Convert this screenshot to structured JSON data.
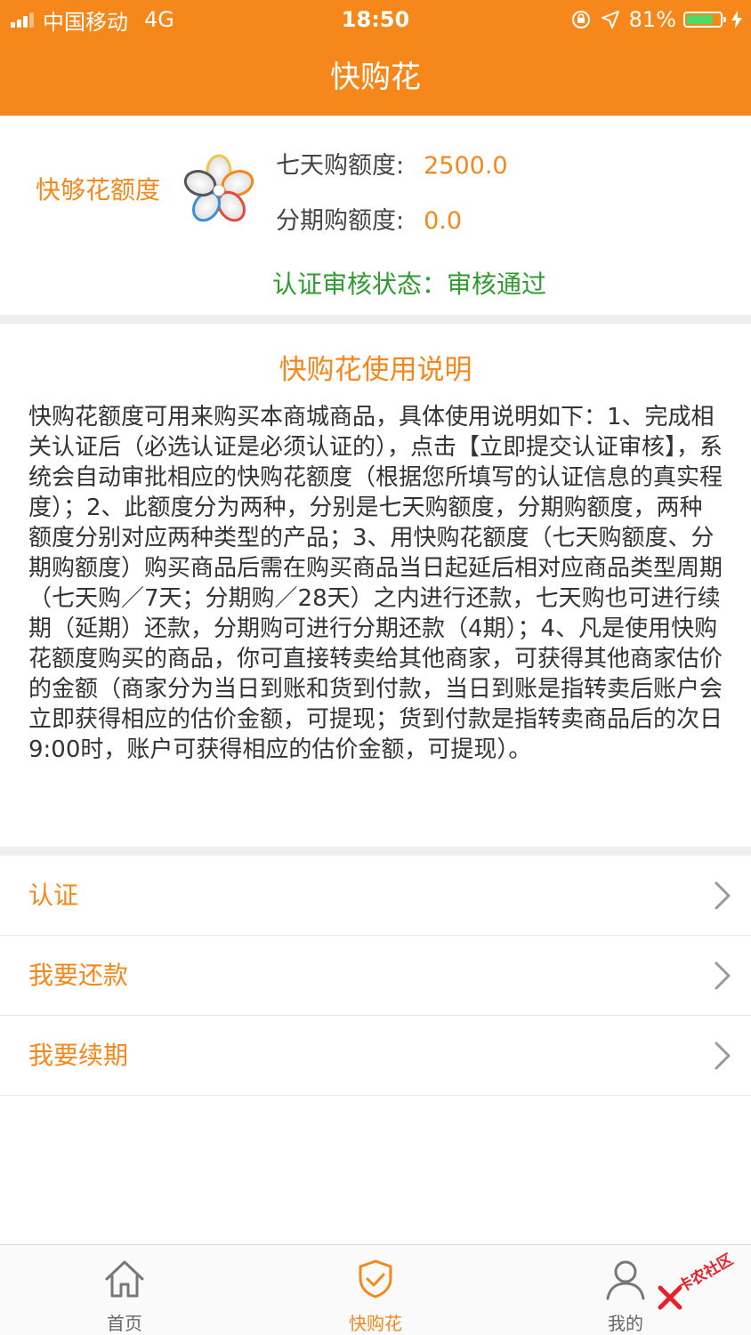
{
  "status_bar": {
    "carrier": "中国移动",
    "network": "4G",
    "time": "18:50",
    "battery_percent": "81%",
    "battery_level": 0.81
  },
  "nav": {
    "title": "快购花"
  },
  "quota": {
    "label": "快够花额度",
    "seven_day_label": "七天购额度:",
    "seven_day_value": "2500.0",
    "installment_label": "分期购额度:",
    "installment_value": "0.0",
    "auth_status": "认证审核状态：审核通过"
  },
  "instructions": {
    "title": "快购花使用说明",
    "body": "快购花额度可用来购买本商城商品，具体使用说明如下：1、完成相关认证后（必选认证是必须认证的），点击【立即提交认证审核】，系统会自动审批相应的快购花额度（根据您所填写的认证信息的真实程度）；2、此额度分为两种，分别是七天购额度，分期购额度，两种额度分别对应两种类型的产品；3、用快购花额度（七天购额度、分期购额度）购买商品后需在购买商品当日起延后相对应商品类型周期（七天购／7天；分期购／28天）之内进行还款，七天购也可进行续期（延期）还款，分期购可进行分期还款（4期）；4、凡是使用快购花额度购买的商品，你可直接转卖给其他商家，可获得其他商家估价的金额（商家分为当日到账和货到付款，当日到账是指转卖后账户会立即获得相应的估价金额，可提现；货到付款是指转卖商品后的次日9:00时，账户可获得相应的估价金额，可提现）。"
  },
  "menu": {
    "items": [
      {
        "label": "认证"
      },
      {
        "label": "我要还款"
      },
      {
        "label": "我要续期"
      }
    ]
  },
  "tabs": [
    {
      "label": "首页",
      "icon": "home-icon"
    },
    {
      "label": "快购花",
      "icon": "shield-check-icon"
    },
    {
      "label": "我的",
      "icon": "user-icon"
    }
  ],
  "watermark": {
    "text": "卡农社区"
  },
  "colors": {
    "accent": "#f5871b",
    "success": "#2f9b2f",
    "battery": "#4cd964"
  }
}
